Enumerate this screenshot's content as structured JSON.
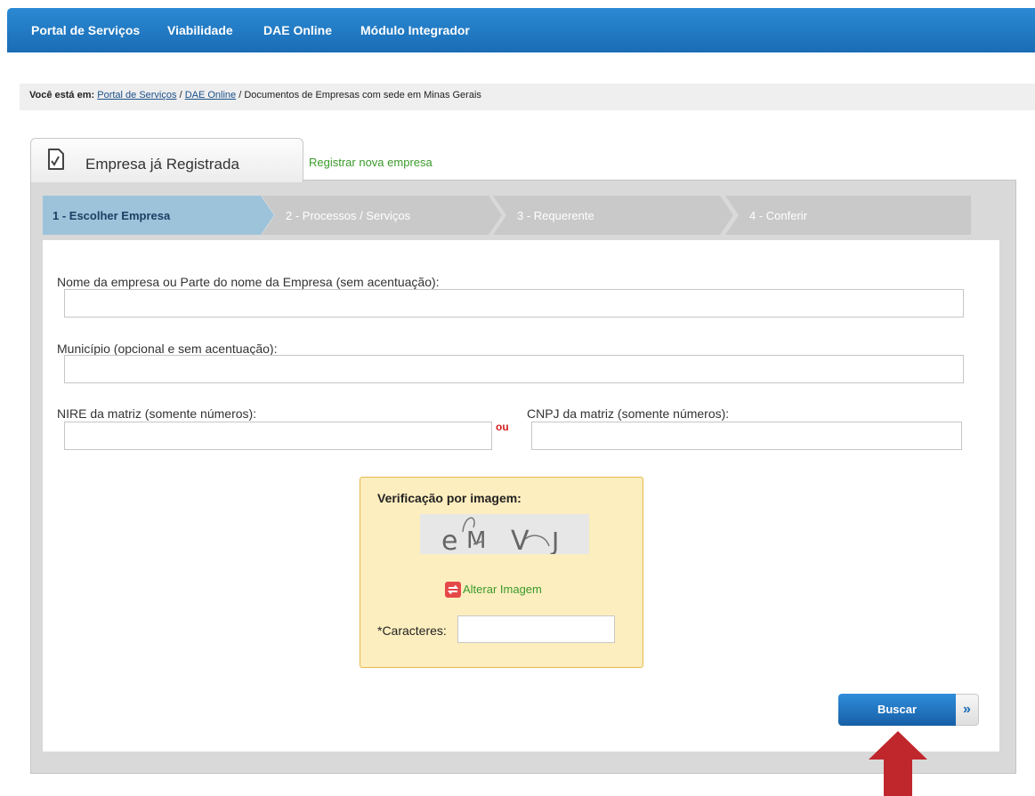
{
  "nav": {
    "items": [
      {
        "label": "Portal de Serviços"
      },
      {
        "label": "Viabilidade"
      },
      {
        "label": "DAE Online"
      },
      {
        "label": "Módulo Integrador"
      }
    ]
  },
  "breadcrumb": {
    "prefix": "Você está em:",
    "links": [
      "Portal de Serviços",
      "DAE Online"
    ],
    "separator": "/",
    "current": "/ Documentos de Empresas com sede em Minas Gerais"
  },
  "tabs": {
    "active_label": "Empresa já Registrada",
    "new_label": "Registrar nova empresa"
  },
  "steps": [
    {
      "label": "1 - Escolher Empresa",
      "active": true
    },
    {
      "label": "2 - Processos / Serviços",
      "active": false
    },
    {
      "label": "3 - Requerente",
      "active": false
    },
    {
      "label": "4 - Conferir",
      "active": false
    }
  ],
  "form": {
    "company_name_label": "Nome da empresa ou Parte do nome da Empresa (sem acentuação):",
    "company_name_value": "",
    "municipality_label": "Município (opcional e sem acentuação):",
    "municipality_value": "",
    "nire_label": "NIRE da matriz (somente números):",
    "nire_value": "",
    "or_label": "ou",
    "cnpj_label": "CNPJ da matriz (somente números):",
    "cnpj_value": ""
  },
  "captcha": {
    "title": "Verificação por imagem:",
    "image_text": "eMVJ",
    "refresh_label": "Alterar Imagem",
    "characters_label": "*Caracteres:",
    "characters_value": ""
  },
  "buttons": {
    "search_label": "Buscar",
    "search_arrow": "»"
  },
  "colors": {
    "nav_bg": "#1f78c4",
    "step_active": "#9dc3db",
    "step_inactive": "#c9c9c9",
    "link_green": "#3a9a2a",
    "annotation_arrow": "#c0272d"
  }
}
